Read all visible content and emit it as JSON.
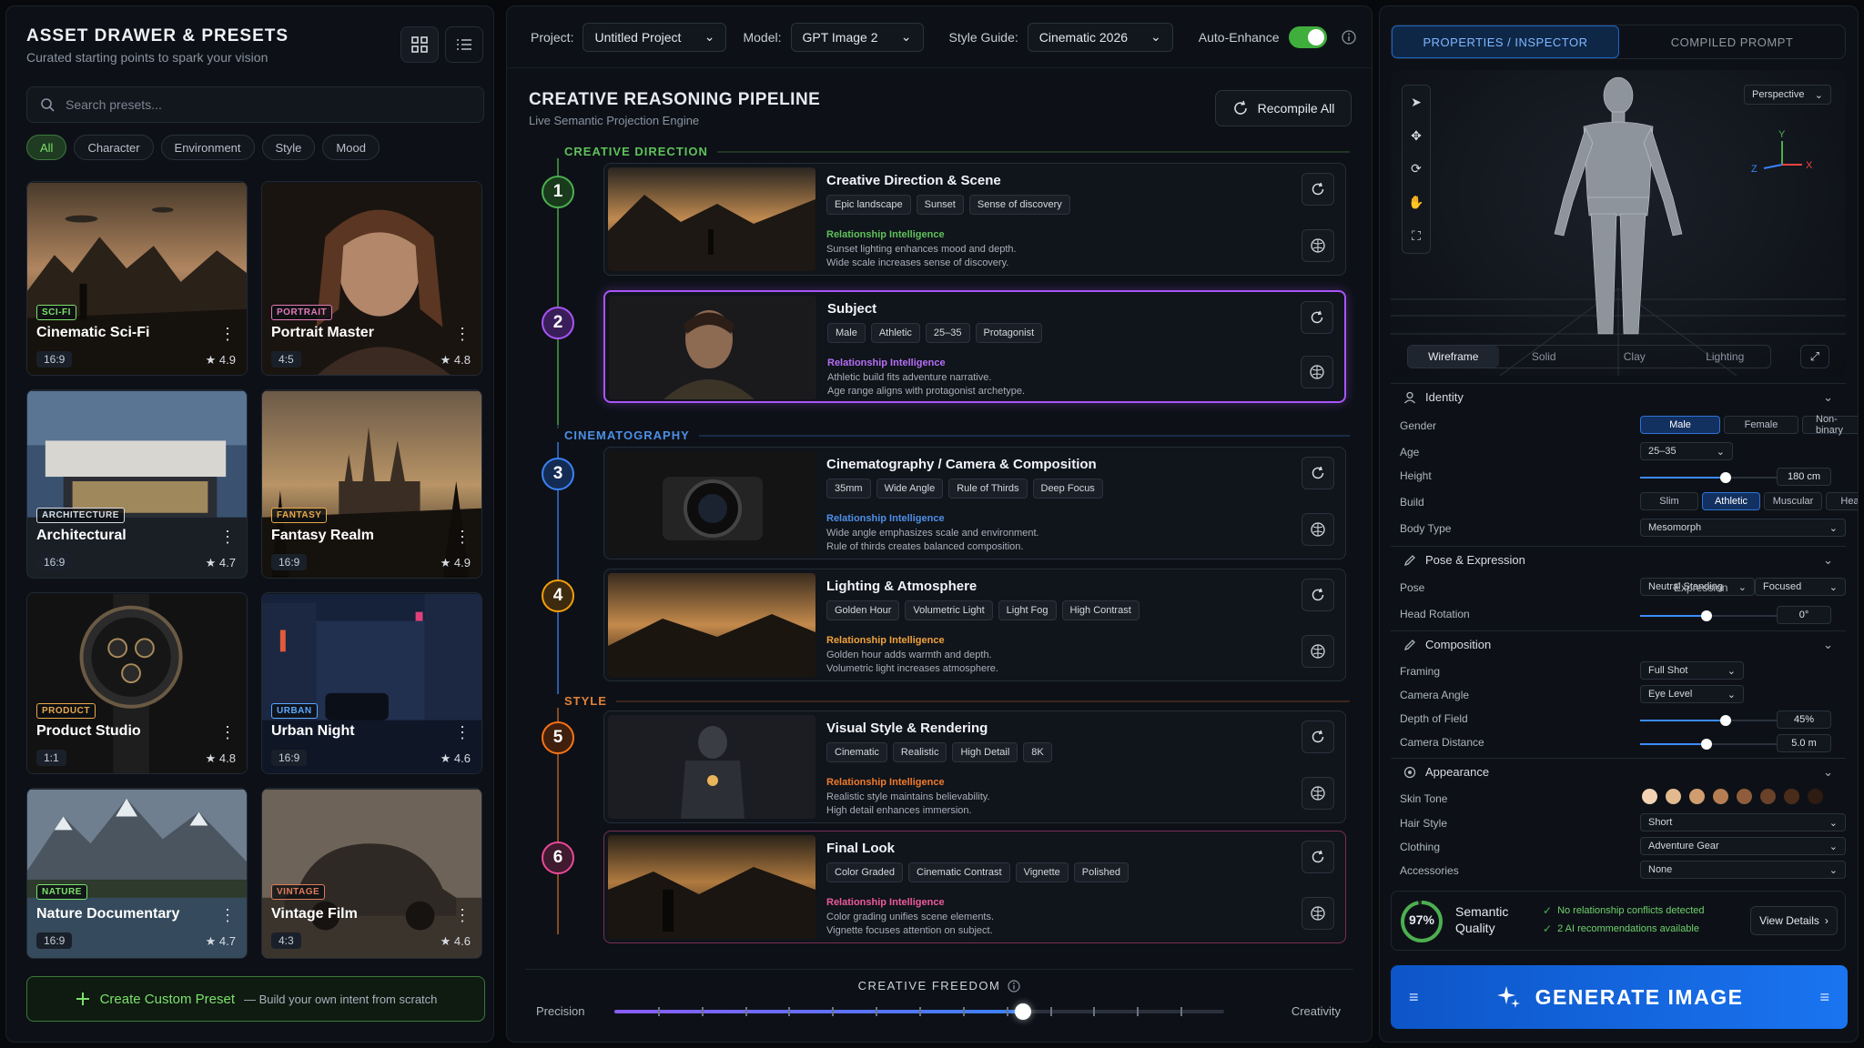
{
  "left": {
    "title": "ASSET DRAWER & PRESETS",
    "subtitle": "Curated starting points to spark your vision",
    "search_placeholder": "Search presets...",
    "filters": [
      "All",
      "Character",
      "Environment",
      "Style",
      "Mood"
    ],
    "presets": [
      {
        "tag": "SCI-FI",
        "name": "Cinematic Sci-Fi",
        "ratio": "16:9",
        "rating": "4.9",
        "tag_color": "#7be16b"
      },
      {
        "tag": "PORTRAIT",
        "name": "Portrait Master",
        "ratio": "4:5",
        "rating": "4.8",
        "tag_color": "#e07ab8"
      },
      {
        "tag": "ARCHITECTURE",
        "name": "Architectural",
        "ratio": "16:9",
        "rating": "4.7",
        "tag_color": "#d6dbe2"
      },
      {
        "tag": "FANTASY",
        "name": "Fantasy Realm",
        "ratio": "16:9",
        "rating": "4.9",
        "tag_color": "#e8a84a"
      },
      {
        "tag": "PRODUCT",
        "name": "Product Studio",
        "ratio": "1:1",
        "rating": "4.8",
        "tag_color": "#e8a84a"
      },
      {
        "tag": "URBAN",
        "name": "Urban Night",
        "ratio": "16:9",
        "rating": "4.6",
        "tag_color": "#5aa8ff"
      },
      {
        "tag": "NATURE",
        "name": "Nature Documentary",
        "ratio": "16:9",
        "rating": "4.7",
        "tag_color": "#7be16b"
      },
      {
        "tag": "VINTAGE",
        "name": "Vintage Film",
        "ratio": "4:3",
        "rating": "4.6",
        "tag_color": "#e07a5a"
      }
    ],
    "create_label": "Create Custom Preset",
    "create_sub": "— Build your own intent from scratch"
  },
  "center": {
    "project_label": "Project:",
    "project_value": "Untitled Project",
    "model_label": "Model:",
    "model_value": "GPT Image 2",
    "style_label": "Style Guide:",
    "style_value": "Cinematic 2026",
    "enhance_label": "Auto-Enhance",
    "title": "CREATIVE REASONING PIPELINE",
    "subtitle": "Live Semantic Projection Engine",
    "recompile": "Recompile All",
    "sections": [
      "CREATIVE DIRECTION",
      "CINEMATOGRAPHY",
      "STYLE"
    ],
    "steps": [
      {
        "n": "1",
        "title": "Creative Direction & Scene",
        "tags": [
          "Epic landscape",
          "Sunset",
          "Sense of discovery"
        ],
        "rl": "Relationship Intelligence",
        "r1": "Sunset lighting enhances mood and depth.",
        "r2": "Wide scale increases sense of discovery.",
        "color": "#4caf50"
      },
      {
        "n": "2",
        "title": "Subject",
        "tags": [
          "Male",
          "Athletic",
          "25–35",
          "Protagonist"
        ],
        "rl": "Relationship Intelligence",
        "r1": "Athletic build fits adventure narrative.",
        "r2": "Age range aligns with protagonist archetype.",
        "color": "#a855f7"
      },
      {
        "n": "3",
        "title": "Cinematography / Camera & Composition",
        "tags": [
          "35mm",
          "Wide Angle",
          "Rule of Thirds",
          "Deep Focus"
        ],
        "rl": "Relationship Intelligence",
        "r1": "Wide angle emphasizes scale and environment.",
        "r2": "Rule of thirds creates balanced composition.",
        "color": "#3b82f6"
      },
      {
        "n": "4",
        "title": "Lighting & Atmosphere",
        "tags": [
          "Golden Hour",
          "Volumetric Light",
          "Light Fog",
          "High Contrast"
        ],
        "rl": "Relationship Intelligence",
        "r1": "Golden hour adds warmth and depth.",
        "r2": "Volumetric light increases atmosphere.",
        "color": "#f59e0b"
      },
      {
        "n": "5",
        "title": "Visual Style & Rendering",
        "tags": [
          "Cinematic",
          "Realistic",
          "High Detail",
          "8K"
        ],
        "rl": "Relationship Intelligence",
        "r1": "Realistic style maintains believability.",
        "r2": "High detail enhances immersion.",
        "color": "#f97316"
      },
      {
        "n": "6",
        "title": "Final Look",
        "tags": [
          "Color Graded",
          "Cinematic Contrast",
          "Vignette",
          "Polished"
        ],
        "rl": "Relationship Intelligence",
        "r1": "Color grading unifies scene elements.",
        "r2": "Vignette focuses attention on subject.",
        "color": "#ec4899"
      }
    ],
    "freedom_title": "CREATIVE FREEDOM",
    "precision": "Precision",
    "creativity": "Creativity",
    "freedom_value": 0.67
  },
  "right": {
    "tab1": "PROPERTIES / INSPECTOR",
    "tab2": "COMPILED PROMPT",
    "perspective": "Perspective",
    "modes": [
      "Wireframe",
      "Solid",
      "Clay",
      "Lighting"
    ],
    "identity": "Identity",
    "gender_label": "Gender",
    "genders": [
      "Male",
      "Female",
      "Non-binary"
    ],
    "age_label": "Age",
    "age": "25–35",
    "height_label": "Height",
    "height": "180 cm",
    "height_level": 0.48,
    "build_label": "Build",
    "builds": [
      "Slim",
      "Athletic",
      "Muscular",
      "Heavy"
    ],
    "body_label": "Body Type",
    "body": "Mesomorph",
    "pose_section": "Pose & Expression",
    "pose_label": "Pose",
    "pose": "Neutral Standing",
    "expr_label": "Expression",
    "expr": "Focused",
    "rotation_label": "Head Rotation",
    "rotation": "0°",
    "rotation_level": 0.37,
    "comp_section": "Composition",
    "framing_label": "Framing",
    "framing": "Full Shot",
    "angle_label": "Camera Angle",
    "angle": "Eye Level",
    "dof_label": "Depth of Field",
    "dof": "45%",
    "dof_level": 0.48,
    "dist_label": "Camera Distance",
    "dist": "5.0 m",
    "dist_level": 0.37,
    "appearance": "Appearance",
    "skin_label": "Skin Tone",
    "skin_tones": [
      "#f2d3b3",
      "#e3b98f",
      "#d19d6f",
      "#b57d52",
      "#8f5d3b",
      "#6a4129",
      "#4a2c1b",
      "#2e1b12"
    ],
    "hair_label": "Hair Style",
    "hair": "Short",
    "cloth_label": "Clothing",
    "cloth": "Adventure Gear",
    "acc_label": "Accessories",
    "acc": "None",
    "quality": "97%",
    "quality_level": 0.97,
    "quality_l1": "Semantic",
    "quality_l2": "Quality",
    "check1": "No relationship conflicts detected",
    "check2": "2 AI recommendations available",
    "details": "View Details",
    "generate": "GENERATE IMAGE"
  }
}
